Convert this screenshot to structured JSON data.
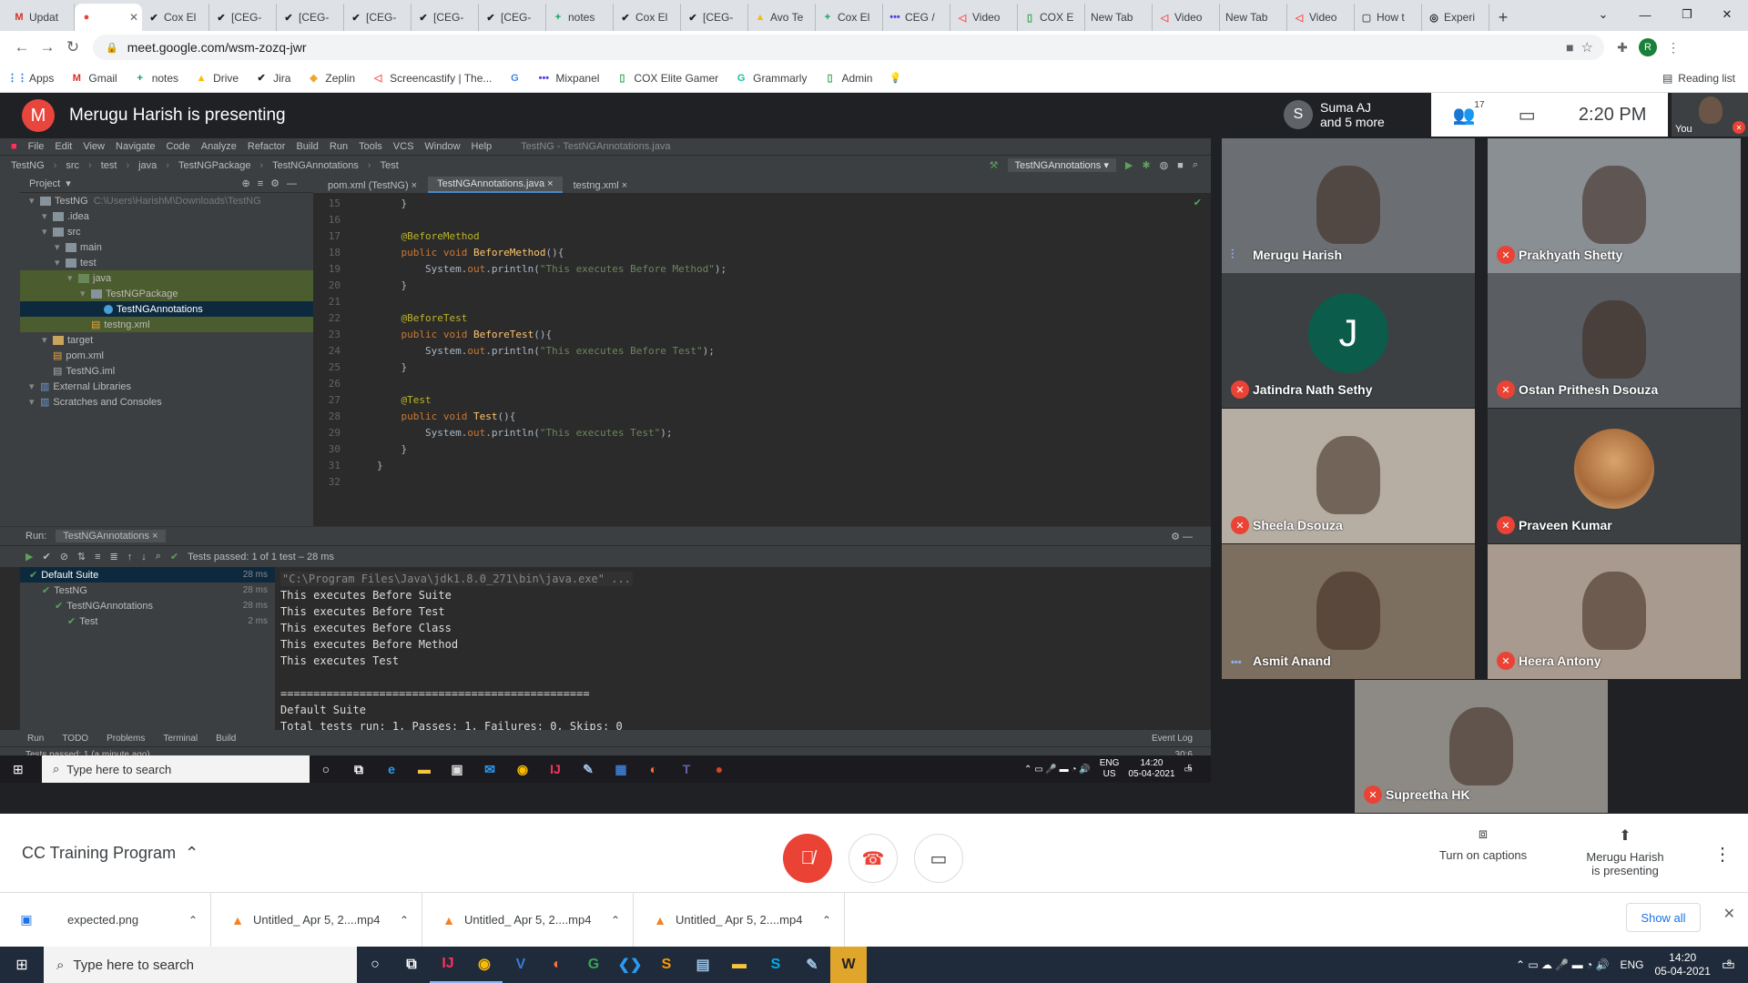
{
  "browser": {
    "tabs": [
      {
        "label": "Updat",
        "icon": "gmail-icon",
        "glyph": "M",
        "color": "#d93025"
      },
      {
        "label": "",
        "icon": "meet-icon",
        "glyph": "●",
        "color": "#ea4335",
        "active": true
      },
      {
        "label": "Cox El",
        "icon": "jira-icon",
        "glyph": "✔",
        "color": "#202124"
      },
      {
        "label": "[CEG-",
        "icon": "jira-icon",
        "glyph": "✔",
        "color": "#202124"
      },
      {
        "label": "[CEG-",
        "icon": "jira-icon",
        "glyph": "✔",
        "color": "#202124"
      },
      {
        "label": "[CEG-",
        "icon": "jira-icon",
        "glyph": "✔",
        "color": "#202124"
      },
      {
        "label": "[CEG-",
        "icon": "jira-icon",
        "glyph": "✔",
        "color": "#202124"
      },
      {
        "label": "[CEG-",
        "icon": "jira-icon",
        "glyph": "✔",
        "color": "#202124"
      },
      {
        "label": "notes",
        "icon": "sheets-icon",
        "glyph": "+",
        "color": "#0f9d58"
      },
      {
        "label": "Cox El",
        "icon": "jira-icon",
        "glyph": "✔",
        "color": "#202124"
      },
      {
        "label": "[CEG-",
        "icon": "jira-icon",
        "glyph": "✔",
        "color": "#202124"
      },
      {
        "label": "Avo Te",
        "icon": "drive-icon",
        "glyph": "▲",
        "color": "#fbbc04"
      },
      {
        "label": "Cox El",
        "icon": "sheets-icon",
        "glyph": "+",
        "color": "#0f9d58"
      },
      {
        "label": "CEG /",
        "icon": "mixpanel-icon",
        "glyph": "•••",
        "color": "#4f44e0"
      },
      {
        "label": "Video",
        "icon": "screencastify-icon",
        "glyph": "◁",
        "color": "#ff5252"
      },
      {
        "label": "COX E",
        "icon": "coxelite-icon",
        "glyph": "▯",
        "color": "#34a853"
      },
      {
        "label": "New Tab",
        "icon": "",
        "glyph": "",
        "color": "#202124"
      },
      {
        "label": "Video",
        "icon": "screencastify-icon",
        "glyph": "◁",
        "color": "#ff5252"
      },
      {
        "label": "New Tab",
        "icon": "",
        "glyph": "",
        "color": "#202124"
      },
      {
        "label": "Video",
        "icon": "screencastify-icon",
        "glyph": "◁",
        "color": "#ff5252"
      },
      {
        "label": "How t",
        "icon": "page-icon",
        "glyph": "▢",
        "color": "#5f6368"
      },
      {
        "label": "Experi",
        "icon": "experiment-icon",
        "glyph": "◎",
        "color": "#202124"
      }
    ],
    "url": "meet.google.com/wsm-zozq-jwr",
    "profile_initial": "R",
    "bookmarks": [
      {
        "label": "Apps",
        "glyph": "⋮⋮",
        "color": "#1a73e8"
      },
      {
        "label": "Gmail",
        "glyph": "M",
        "color": "#d93025"
      },
      {
        "label": "notes",
        "glyph": "+",
        "color": "#0f9d58"
      },
      {
        "label": "Drive",
        "glyph": "▲",
        "color": "#fbbc04"
      },
      {
        "label": "Jira",
        "glyph": "✔",
        "color": "#202124"
      },
      {
        "label": "Zeplin",
        "glyph": "◆",
        "color": "#f3a530"
      },
      {
        "label": "Screencastify | The...",
        "glyph": "◁",
        "color": "#ff5252"
      },
      {
        "label": "",
        "glyph": "G",
        "color": "#4285f4"
      },
      {
        "label": "Mixpanel",
        "glyph": "•••",
        "color": "#4f44e0"
      },
      {
        "label": "COX Elite Gamer",
        "glyph": "▯",
        "color": "#34a853"
      },
      {
        "label": "Grammarly",
        "glyph": "G",
        "color": "#15c39a"
      },
      {
        "label": "Admin",
        "glyph": "▯",
        "color": "#34a853"
      },
      {
        "label": "",
        "glyph": "💡",
        "color": "#202124"
      }
    ],
    "reading_list": "Reading list"
  },
  "meet": {
    "presenter_initial": "M",
    "presenting_title": "Merugu Harish is presenting",
    "info_initial": "S",
    "info_line1": "Suma AJ",
    "info_line2": "and 5 more",
    "people_count": "17",
    "time": "2:20 PM",
    "self_label": "You",
    "meeting_name": "CC Training Program",
    "captions_label": "Turn on captions",
    "presenting_line1": "Merugu Harish",
    "presenting_line2": "is presenting",
    "participants": [
      {
        "name": "Merugu Harish",
        "muted": false,
        "speaking": true,
        "bg": "#6b6f73"
      },
      {
        "name": "Prakhyath Shetty",
        "muted": true,
        "bg": "#8a8f94"
      },
      {
        "name": "Jatindra Nath Sethy",
        "muted": true,
        "letter": "J",
        "bg": "#3c4043"
      },
      {
        "name": "Ostan Prithesh Dsouza",
        "muted": true,
        "bg": "#5a5e62"
      },
      {
        "name": "Sheela Dsouza",
        "muted": true,
        "bg": "#b7aea3"
      },
      {
        "name": "Praveen Kumar",
        "muted": true,
        "photo": true,
        "bg": "#3c4043"
      },
      {
        "name": "Asmit Anand",
        "muted": false,
        "speaking_dots": true,
        "bg": "#7d6f60"
      },
      {
        "name": "Heera Antony",
        "muted": true,
        "bg": "#a89a8e"
      },
      {
        "name": "Supreetha HK",
        "muted": true,
        "bg": "#8d8a86"
      }
    ]
  },
  "ide": {
    "menu": [
      "File",
      "Edit",
      "View",
      "Navigate",
      "Code",
      "Analyze",
      "Refactor",
      "Build",
      "Run",
      "Tools",
      "VCS",
      "Window",
      "Help"
    ],
    "window_title": "TestNG - TestNGAnnotations.java",
    "breadcrumb": [
      "TestNG",
      "src",
      "test",
      "java",
      "TestNGPackage",
      "TestNGAnnotations",
      "Test"
    ],
    "run_config": "TestNGAnnotations",
    "project_header": "Project",
    "tree": [
      {
        "label": "TestNG",
        "path": "C:\\Users\\HarishM\\Downloads\\TestNG",
        "depth": 0,
        "type": "folder"
      },
      {
        "label": ".idea",
        "depth": 1,
        "type": "folder"
      },
      {
        "label": "src",
        "depth": 1,
        "type": "folder"
      },
      {
        "label": "main",
        "depth": 2,
        "type": "folder"
      },
      {
        "label": "test",
        "depth": 2,
        "type": "folder"
      },
      {
        "label": "java",
        "depth": 3,
        "type": "folder-green",
        "hl": true
      },
      {
        "label": "TestNGPackage",
        "depth": 4,
        "type": "folder",
        "hl": true
      },
      {
        "label": "TestNGAnnotations",
        "depth": 5,
        "type": "java",
        "sel": true
      },
      {
        "label": "testng.xml",
        "depth": 4,
        "type": "xml",
        "hl": true
      },
      {
        "label": "target",
        "depth": 1,
        "type": "folder-yellow"
      },
      {
        "label": "pom.xml",
        "depth": 1,
        "type": "xml"
      },
      {
        "label": "TestNG.iml",
        "depth": 1,
        "type": "file"
      },
      {
        "label": "External Libraries",
        "depth": 0,
        "type": "lib"
      },
      {
        "label": "Scratches and Consoles",
        "depth": 0,
        "type": "lib"
      }
    ],
    "editor_tabs": [
      {
        "label": "pom.xml (TestNG)",
        "active": false
      },
      {
        "label": "TestNGAnnotations.java",
        "active": true
      },
      {
        "label": "testng.xml",
        "active": false
      }
    ],
    "code": [
      {
        "n": "15",
        "parts": [
          {
            "c": "pl",
            "t": "    }"
          }
        ]
      },
      {
        "n": "16",
        "parts": [
          {
            "c": "pl",
            "t": ""
          }
        ]
      },
      {
        "n": "17",
        "parts": [
          {
            "c": "an",
            "t": "    @BeforeMethod"
          }
        ]
      },
      {
        "n": "18",
        "parts": [
          {
            "c": "kw",
            "t": "    public void "
          },
          {
            "c": "fn",
            "t": "BeforeMethod"
          },
          {
            "c": "pl",
            "t": "(){"
          }
        ]
      },
      {
        "n": "19",
        "parts": [
          {
            "c": "pl",
            "t": "        System."
          },
          {
            "c": "kw",
            "t": "out"
          },
          {
            "c": "pl",
            "t": ".println("
          },
          {
            "c": "st",
            "t": "\"This executes Before Method\""
          },
          {
            "c": "pl",
            "t": ");"
          }
        ]
      },
      {
        "n": "20",
        "parts": [
          {
            "c": "pl",
            "t": "    }"
          }
        ]
      },
      {
        "n": "21",
        "parts": [
          {
            "c": "pl",
            "t": ""
          }
        ]
      },
      {
        "n": "22",
        "parts": [
          {
            "c": "an",
            "t": "    @BeforeTest"
          }
        ]
      },
      {
        "n": "23",
        "parts": [
          {
            "c": "kw",
            "t": "    public void "
          },
          {
            "c": "fn",
            "t": "BeforeTest"
          },
          {
            "c": "pl",
            "t": "(){"
          }
        ]
      },
      {
        "n": "24",
        "parts": [
          {
            "c": "pl",
            "t": "        System."
          },
          {
            "c": "kw",
            "t": "out"
          },
          {
            "c": "pl",
            "t": ".println("
          },
          {
            "c": "st",
            "t": "\"This executes Before Test\""
          },
          {
            "c": "pl",
            "t": ");"
          }
        ]
      },
      {
        "n": "25",
        "parts": [
          {
            "c": "pl",
            "t": "    }"
          }
        ]
      },
      {
        "n": "26",
        "parts": [
          {
            "c": "pl",
            "t": ""
          }
        ]
      },
      {
        "n": "27",
        "parts": [
          {
            "c": "an",
            "t": "    @Test"
          }
        ]
      },
      {
        "n": "28",
        "parts": [
          {
            "c": "kw",
            "t": "    public void "
          },
          {
            "c": "fn",
            "t": "Test"
          },
          {
            "c": "pl",
            "t": "(){"
          }
        ]
      },
      {
        "n": "29",
        "parts": [
          {
            "c": "pl",
            "t": "        System."
          },
          {
            "c": "kw",
            "t": "out"
          },
          {
            "c": "pl",
            "t": ".println("
          },
          {
            "c": "st",
            "t": "\"This executes Test\""
          },
          {
            "c": "pl",
            "t": ");"
          }
        ]
      },
      {
        "n": "30",
        "parts": [
          {
            "c": "pl",
            "t": "    }"
          }
        ]
      },
      {
        "n": "31",
        "parts": [
          {
            "c": "pl",
            "t": "}"
          }
        ]
      },
      {
        "n": "32",
        "parts": [
          {
            "c": "pl",
            "t": ""
          }
        ]
      }
    ],
    "run_label": "Run:",
    "run_tab": "TestNGAnnotations",
    "tests_passed": "Tests passed: 1 of 1 test – 28 ms",
    "run_tree": [
      {
        "label": "Default Suite",
        "time": "28 ms",
        "depth": 0,
        "sel": true
      },
      {
        "label": "TestNG",
        "time": "28 ms",
        "depth": 1
      },
      {
        "label": "TestNGAnnotations",
        "time": "28 ms",
        "depth": 2
      },
      {
        "label": "Test",
        "time": "2 ms",
        "depth": 3
      }
    ],
    "console_cmd": "\"C:\\Program Files\\Java\\jdk1.8.0_271\\bin\\java.exe\" ...",
    "console": [
      "This executes Before Suite",
      "This executes Before Test",
      "This executes Before Class",
      "This executes Before Method",
      "This executes Test",
      "",
      "===============================================",
      "Default Suite",
      "Total tests run: 1, Passes: 1, Failures: 0, Skips: 0"
    ],
    "bottom_tabs": [
      "Run",
      "TODO",
      "Problems",
      "Terminal",
      "Build"
    ],
    "event_log": "Event Log",
    "status_text": "Tests passed: 1 (a minute ago)",
    "cursor_pos": "30:6",
    "inner_taskbar_search": "Type here to search",
    "inner_lang": "ENG",
    "inner_region": "US",
    "inner_time": "14:20",
    "inner_date": "05-04-2021",
    "inner_notif": "5"
  },
  "downloads": [
    {
      "name": "expected.png",
      "icon": "image-file-icon",
      "glyph": "▣",
      "color": "#1a73e8"
    },
    {
      "name": "Untitled_ Apr 5, 2....mp4",
      "icon": "vlc-icon",
      "glyph": "▲",
      "color": "#f48024"
    },
    {
      "name": "Untitled_ Apr 5, 2....mp4",
      "icon": "vlc-icon",
      "glyph": "▲",
      "color": "#f48024"
    },
    {
      "name": "Untitled_ Apr 5, 2....mp4",
      "icon": "vlc-icon",
      "glyph": "▲",
      "color": "#f48024"
    }
  ],
  "show_all": "Show all",
  "os_taskbar": {
    "search": "Type here to search",
    "apps": [
      {
        "name": "cortana-icon",
        "glyph": "○",
        "color": "#ffffff"
      },
      {
        "name": "task-view-icon",
        "glyph": "⧉",
        "color": "#ffffff"
      },
      {
        "name": "intellij-icon",
        "glyph": "IJ",
        "color": "#fe315d"
      },
      {
        "name": "chrome-icon",
        "glyph": "◉",
        "color": "#fbbc04"
      },
      {
        "name": "vc-icon",
        "glyph": "V",
        "color": "#3a7bd5"
      },
      {
        "name": "firefox-icon",
        "glyph": "◐",
        "color": "#ff7139"
      },
      {
        "name": "greenapp-icon",
        "glyph": "G",
        "color": "#34a853"
      },
      {
        "name": "vscode-icon",
        "glyph": "❮❯",
        "color": "#2b9af3"
      },
      {
        "name": "sublime-icon",
        "glyph": "S",
        "color": "#ff9800"
      },
      {
        "name": "notepad-icon",
        "glyph": "▤",
        "color": "#9ec3e6"
      },
      {
        "name": "explorer-icon",
        "glyph": "▬",
        "color": "#f8c440"
      },
      {
        "name": "skype-icon",
        "glyph": "S",
        "color": "#00aff0"
      },
      {
        "name": "paint-icon",
        "glyph": "✎",
        "color": "#9ec3e6"
      },
      {
        "name": "w-app-icon",
        "glyph": "W",
        "color": "#222222"
      }
    ],
    "lang": "ENG",
    "time": "14:20",
    "date": "05-04-2021",
    "notif_count": "8"
  }
}
